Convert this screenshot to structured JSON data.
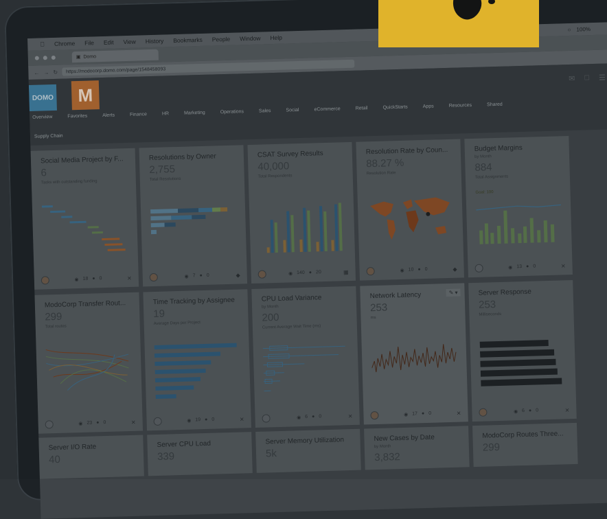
{
  "browser": {
    "menu": [
      "Chrome",
      "File",
      "Edit",
      "View",
      "History",
      "Bookmarks",
      "People",
      "Window",
      "Help"
    ],
    "status": "100%",
    "tab_title": "Domo",
    "url": "https://modocorp.domo.com/page/1548458093"
  },
  "app": {
    "logo": "DOMO",
    "brand_letter": "M",
    "nav": [
      "Overview",
      "Favorites",
      "Alerts",
      "Finance",
      "HR",
      "Marketing",
      "Operations",
      "Sales",
      "Social",
      "eCommerce",
      "Retail",
      "QuickStarts",
      "Apps",
      "Resources",
      "Shared"
    ],
    "subnav": "Supply Chain"
  },
  "cards_row1": [
    {
      "title": "Social Media Project by F...",
      "value": "6",
      "desc": "Tasks with outstanding funding",
      "views": "18",
      "comments": "0"
    },
    {
      "title": "Resolutions by Owner",
      "value": "2,755",
      "desc": "Total Resolutions",
      "views": "7",
      "comments": "0"
    },
    {
      "title": "CSAT Survey Results",
      "value": "40,000",
      "desc": "Total Respondents",
      "views": "140",
      "comments": "20"
    },
    {
      "title": "Resolution Rate by Coun...",
      "value": "88.27 %",
      "desc": "Resolution Rate",
      "views": "10",
      "comments": "0"
    },
    {
      "title": "Budget Margins",
      "sub": "by Month",
      "value": "884",
      "desc": "Total Assignments",
      "goal": "Goal: 100",
      "views": "13",
      "comments": "0"
    }
  ],
  "cards_row2": [
    {
      "title": "ModoCorp Transfer Rout...",
      "value": "299",
      "desc": "Total routes",
      "views": "23",
      "comments": "0"
    },
    {
      "title": "Time Tracking by Assignee",
      "value": "19",
      "desc": "Average Days per Project",
      "views": "19",
      "comments": "0"
    },
    {
      "title": "CPU Load Variance",
      "sub": "by Month",
      "value": "200",
      "desc": "Current Average Wait Time (ms)",
      "views": "6",
      "comments": "0"
    },
    {
      "title": "Network Latency",
      "value": "253",
      "desc": "ms",
      "views": "17",
      "comments": "0"
    },
    {
      "title": "Server Response",
      "value": "253",
      "desc": "Milliseconds",
      "views": "6",
      "comments": "0"
    }
  ],
  "cards_row3": [
    {
      "title": "Server I/O Rate",
      "value": "40"
    },
    {
      "title": "Server CPU Load",
      "value": "339"
    },
    {
      "title": "Server Memory Utilization",
      "value": "5k"
    },
    {
      "title": "New Cases by Date",
      "sub": "by Month",
      "value": "3,832"
    },
    {
      "title": "ModoCorp Routes Three...",
      "value": "299"
    }
  ],
  "colors": {
    "accent_blue": "#3f7ea1",
    "accent_orange": "#b46a32",
    "sticky_yellow": "#fdc92e"
  }
}
